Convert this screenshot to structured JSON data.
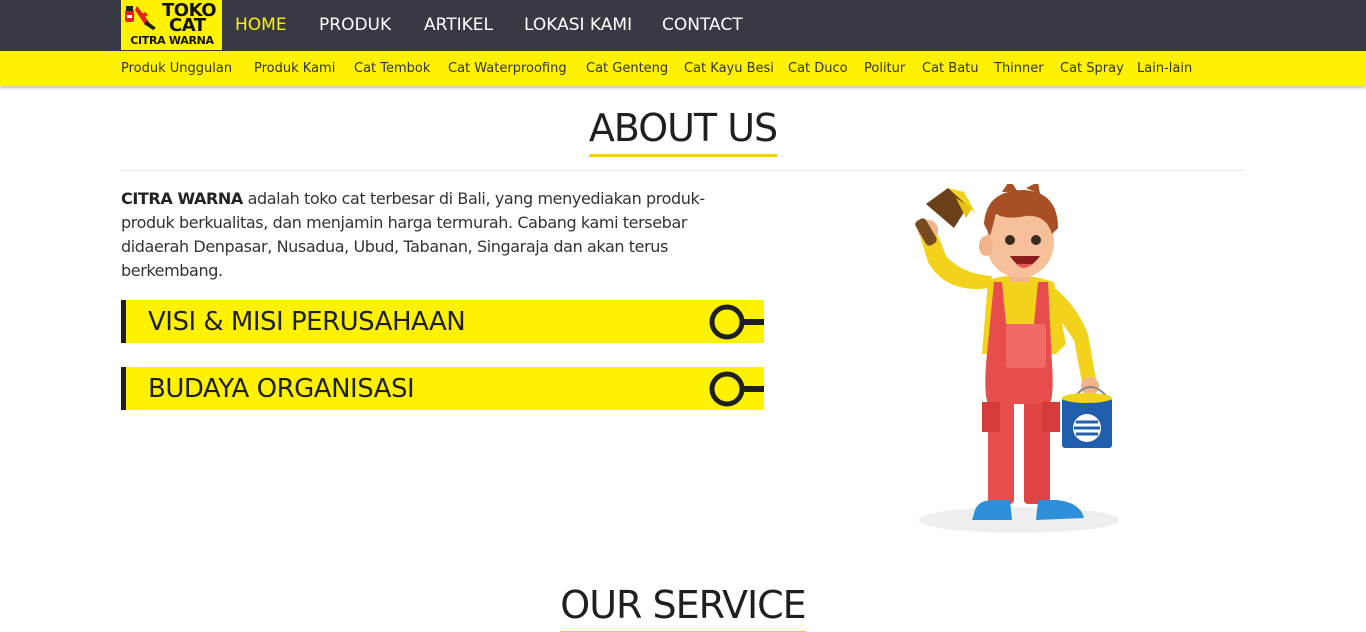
{
  "logo": {
    "line1": "TOKO",
    "line2": "CAT",
    "line3": "CITRA WARNA"
  },
  "nav": {
    "home": "HOME",
    "produk": "PRODUK",
    "artikel": "ARTIKEL",
    "lokasi": "LOKASI KAMI",
    "contact": "CONTACT"
  },
  "categories": [
    "Produk Unggulan",
    "Produk Kami",
    "Cat Tembok",
    "Cat Waterproofing",
    "Cat Genteng",
    "Cat Kayu Besi",
    "Cat Duco",
    "Politur",
    "Cat Batu",
    "Thinner",
    "Cat Spray",
    "Lain-lain"
  ],
  "about": {
    "title": "ABOUT US",
    "brand": "CITRA WARNA",
    "text": " adalah toko cat terbesar di Bali, yang menyediakan produk-produk berkualitas, dan menjamin harga termurah. Cabang kami tersebar didaerah Denpasar, Nusadua, Ubud, Tabanan, Singaraja dan akan terus berkembang."
  },
  "accordion": {
    "visi": "VISI & MISI PERUSAHAAN",
    "budaya": "BUDAYA ORGANISASI"
  },
  "service": {
    "title": "OUR SERVICE"
  },
  "colors": {
    "topbar": "#373a43",
    "accent_yellow": "#fff200",
    "underline": "#f5cc1f",
    "text": "#333333"
  }
}
